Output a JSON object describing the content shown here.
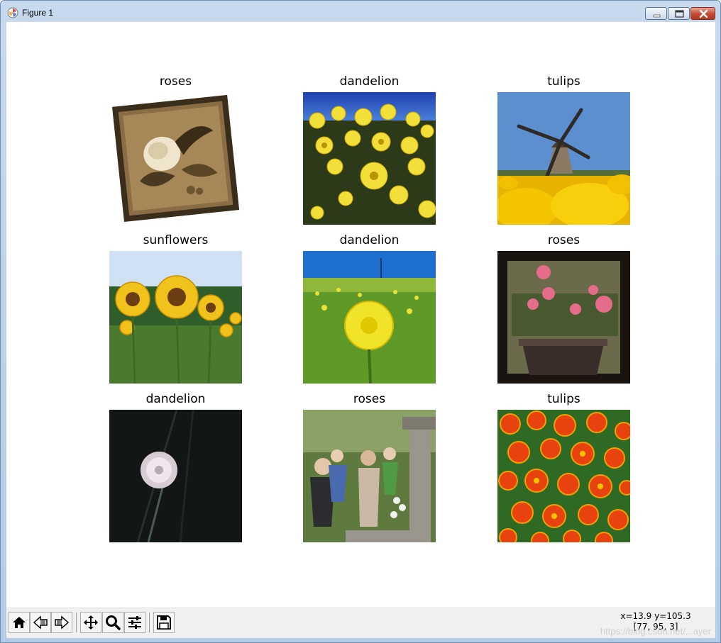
{
  "window": {
    "title": "Figure 1",
    "controls": [
      "minimize",
      "maximize",
      "close"
    ]
  },
  "figure": {
    "panels": [
      {
        "title": "roses",
        "image_icon": "rose-photo"
      },
      {
        "title": "dandelion",
        "image_icon": "dandelion-photo"
      },
      {
        "title": "tulips",
        "image_icon": "windmill-tulips-photo"
      },
      {
        "title": "sunflowers",
        "image_icon": "sunflowers-photo"
      },
      {
        "title": "dandelion",
        "image_icon": "dandelion-field-photo"
      },
      {
        "title": "roses",
        "image_icon": "rose-pot-photo"
      },
      {
        "title": "dandelion",
        "image_icon": "dandelion-seedhead-photo"
      },
      {
        "title": "roses",
        "image_icon": "fountain-family-photo"
      },
      {
        "title": "tulips",
        "image_icon": "red-tulips-photo"
      }
    ]
  },
  "toolbar": {
    "buttons": [
      "home-icon",
      "back-icon",
      "forward-icon",
      "pan-icon",
      "zoom-icon",
      "configure-subplots-icon",
      "save-icon"
    ],
    "coords_line1": "x=13.9 y=105.3",
    "coords_line2": "[77, 95, 3]",
    "watermark": "https://blog.csdn.net/...ayer"
  }
}
